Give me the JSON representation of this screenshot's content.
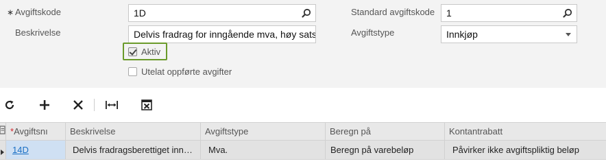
{
  "form": {
    "avgiftskode_label": "Avgiftskode",
    "avgiftskode_value": "1D",
    "beskrivelse_label": "Beskrivelse",
    "beskrivelse_value": "Delvis fradrag for inngående mva, høy sats",
    "aktiv_label": "Aktiv",
    "aktiv_checked": true,
    "utelat_label": "Utelat oppførte avgifter",
    "utelat_checked": false,
    "standard_label": "Standard avgiftskode",
    "standard_value": "1",
    "avgiftstype_label": "Avgiftstype",
    "avgiftstype_value": "Innkjøp"
  },
  "toolbar": {
    "refresh_icon": "refresh-icon",
    "add_icon": "plus-icon",
    "delete_icon": "close-icon",
    "fit_icon": "fit-columns-icon",
    "excel_icon": "excel-export-icon"
  },
  "grid": {
    "columns": [
      "Avgiftsnı",
      "Beskrivelse",
      "Avgiftstype",
      "Beregn på",
      "Kontantrabatt"
    ],
    "rows": [
      [
        "14D",
        "Delvis fradragsberettiget inn…",
        "Mva.",
        "Beregn på varebeløp",
        "Påvirker ikke avgiftspliktig beløp"
      ]
    ]
  },
  "colors": {
    "highlight_border": "#6a9a2a",
    "link": "#1a6fc4",
    "selected_cell": "#cfe0f3"
  }
}
